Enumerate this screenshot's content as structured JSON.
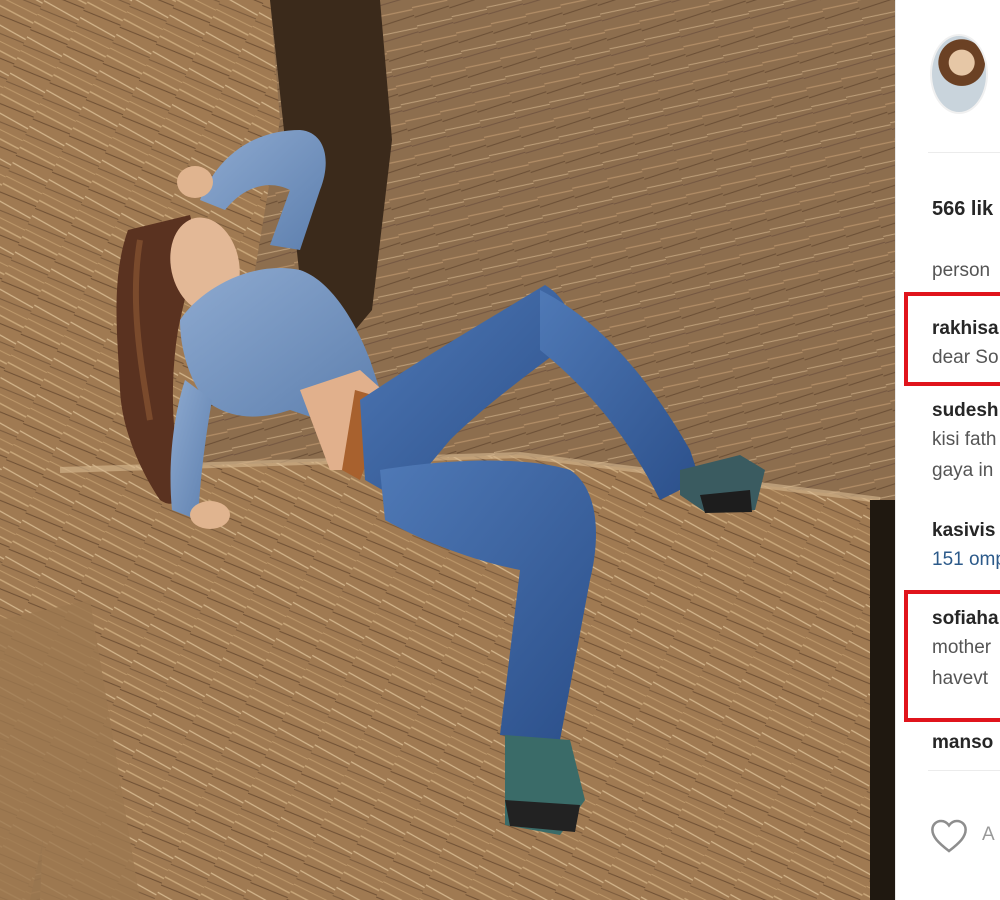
{
  "post": {
    "likes_text": "566 lik",
    "caption_text": "person",
    "comments": [
      {
        "user": "rakhisa",
        "lines": [
          "dear So"
        ]
      },
      {
        "user": "sudesh",
        "lines": [
          "kisi fath",
          "gaya in"
        ]
      },
      {
        "user": "kasivis",
        "link_line": "151 omp"
      },
      {
        "user": "sofiaha",
        "lines": [
          "mother",
          "havevt"
        ]
      },
      {
        "user": "manso"
      }
    ],
    "add_comment_placeholder": "A",
    "highlight_color": "#e0141c"
  },
  "icons": {
    "like": "heart-outline-icon",
    "profile": "avatar"
  }
}
